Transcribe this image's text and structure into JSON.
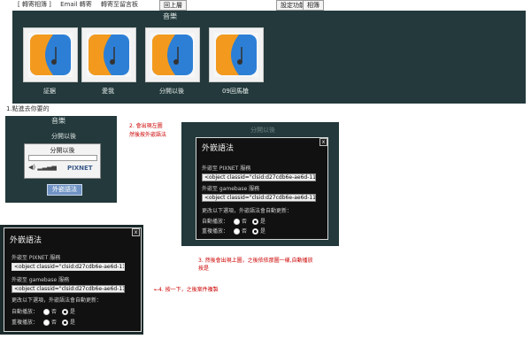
{
  "top_bar": {
    "links": [
      "[ 轉寄相簿 ]",
      "Email 轉寄",
      "轉寄至留言板"
    ],
    "back_button": "回上層",
    "settings_button": "設定功能",
    "related_button": "相簿"
  },
  "album": {
    "title": "音樂",
    "items": [
      {
        "label": "証据"
      },
      {
        "label": "愛我"
      },
      {
        "label": "分開以後"
      },
      {
        "label": "09回馬槍"
      }
    ],
    "caption": "1.點進去你要的"
  },
  "player": {
    "section_title": "音樂",
    "song_name": "分開以後",
    "song_title": "分開以後",
    "progress": 0.0,
    "logo": "PIXNET",
    "embed_button": "外嵌語法"
  },
  "notes": {
    "note2_line1": "2. 會出現左圖",
    "note2_line2": "然後按外嵌語法",
    "note3_line1": "3. 然後會出現上圖，之後依依那圖一樣,自動播放",
    "note3_line2": "按是",
    "note4": "←4. 按一下，之後案件複製"
  },
  "dialog": {
    "title": "外嵌語法",
    "close_symbol": "x",
    "bg_title": "分開以後",
    "pixnet_label": "外嵌至 PIXNET 服務",
    "pixnet_code": "<object classid=\"clsid:d27cdb6e-ae6d-11cf-",
    "gamebase_label": "外嵌至 gamebase 服務",
    "gamebase_code": "<object classid=\"clsid:d27cdb6e-ae6d-11cf-",
    "hint": "更改以下選項，外嵌語法會自動更新：",
    "autoplay_label": "自動播放：",
    "repeat_label": "重複播放：",
    "option_no": "否",
    "option_yes": "是",
    "autoplay_selected": "是",
    "repeat_selected": "是"
  },
  "colors": {
    "panel_bg": "#23393b",
    "dialog_bg": "#111111",
    "note_red": "#cc0000",
    "embed_button_bg": "#6f93c4"
  }
}
